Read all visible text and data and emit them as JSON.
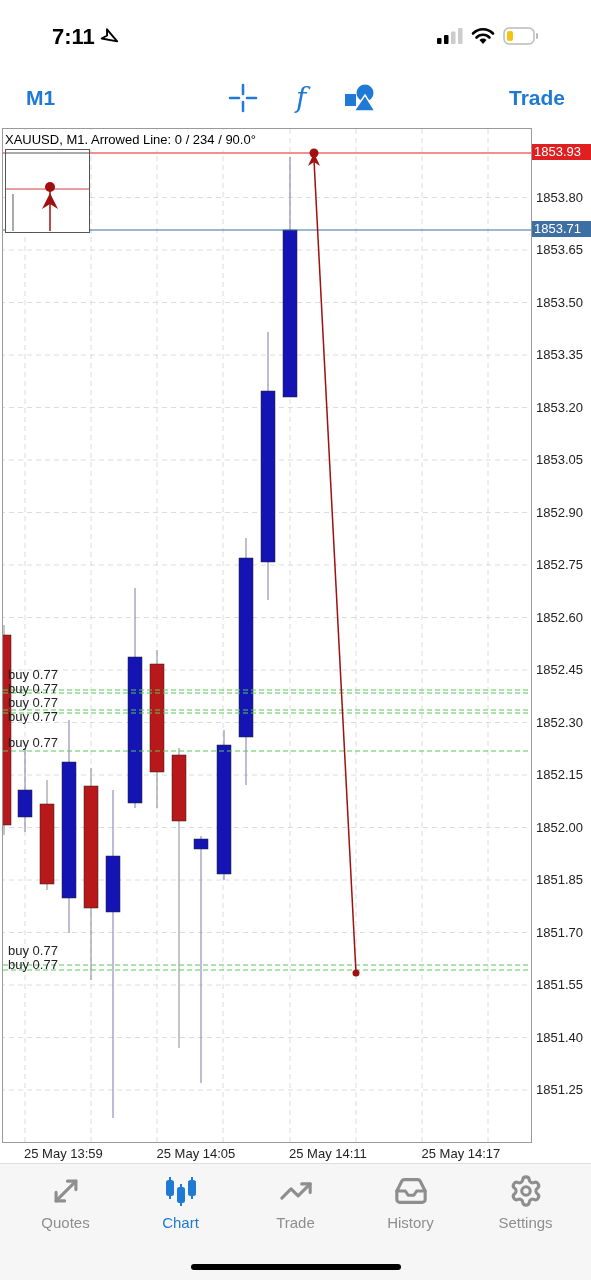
{
  "status_bar": {
    "time": "7:11"
  },
  "toolbar": {
    "timeframe": "M1",
    "function_glyph": "f",
    "trade": "Trade"
  },
  "chart": {
    "title": "XAUUSD, M1. Arrowed Line: 0 / 234 / 90.0°",
    "price_ticks": [
      "1853.80",
      "1853.65",
      "1853.50",
      "1853.35",
      "1853.20",
      "1853.05",
      "1852.90",
      "1852.75",
      "1852.60",
      "1852.45",
      "1852.30",
      "1852.15",
      "1852.00",
      "1851.85",
      "1851.70",
      "1851.55",
      "1851.40",
      "1851.25"
    ],
    "price_tags": [
      {
        "label": "1853.93",
        "color": "#e02020"
      },
      {
        "label": "1853.71",
        "color": "#3d6fa3"
      }
    ],
    "orders": [
      {
        "label": "buy 0.77"
      },
      {
        "label": "buy 0.77"
      },
      {
        "label": "buy 0.77"
      },
      {
        "label": "buy 0.77"
      },
      {
        "label": "buy 0.77"
      },
      {
        "label": "buy 0.77"
      },
      {
        "label": "buy 0.77"
      }
    ],
    "time_labels": [
      "25 May 13:59",
      "25 May 14:05",
      "25 May 14:11",
      "25 May 14:17"
    ]
  },
  "tabs": [
    {
      "label": "Quotes",
      "selected": false
    },
    {
      "label": "Chart",
      "selected": true
    },
    {
      "label": "Trade",
      "selected": false
    },
    {
      "label": "History",
      "selected": false
    },
    {
      "label": "Settings",
      "selected": false
    }
  ]
}
